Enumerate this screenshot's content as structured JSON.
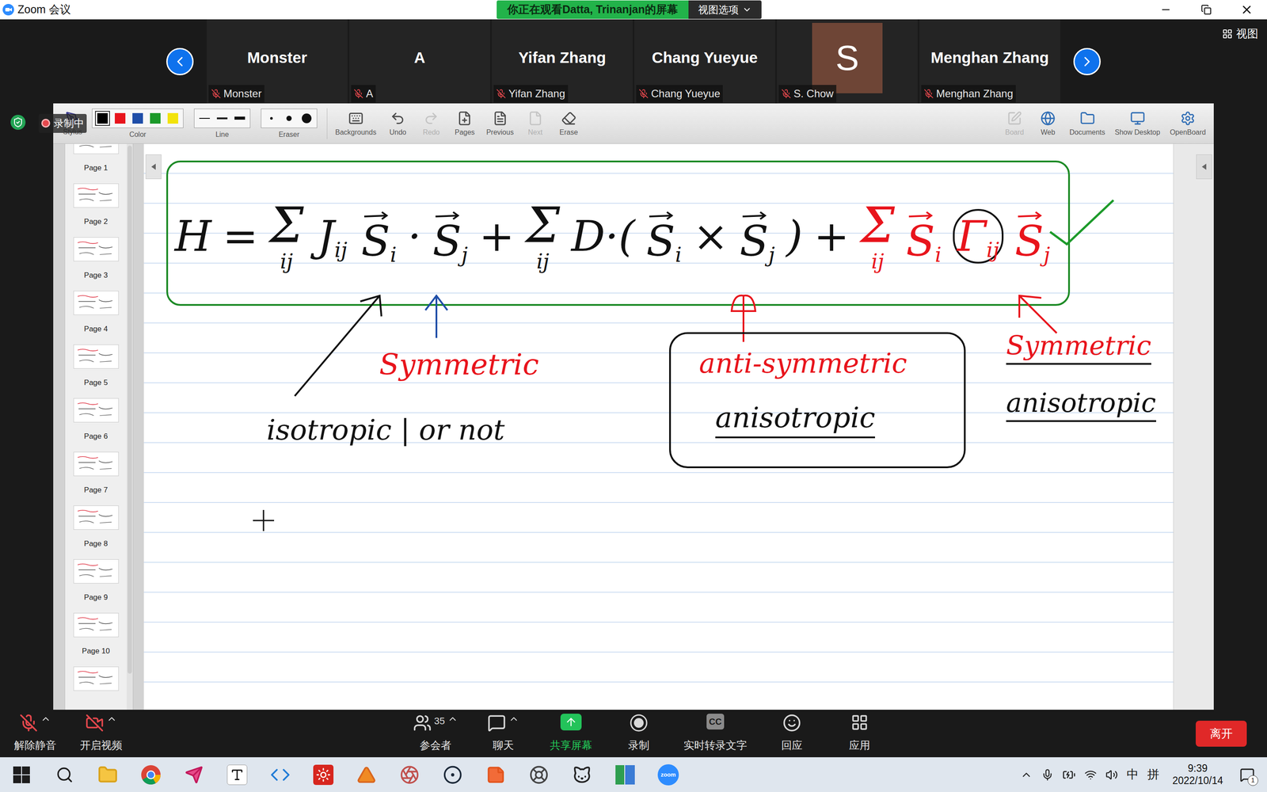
{
  "window": {
    "title": "Zoom 会议"
  },
  "banner": {
    "text": "你正在观看Datta, Trinanjan的屏幕",
    "view_options": "视图选项"
  },
  "participants": [
    {
      "kind": "name",
      "name": "Monster",
      "label": "Monster",
      "muted": true
    },
    {
      "kind": "name",
      "name": "A",
      "label": "A",
      "muted": true
    },
    {
      "kind": "name",
      "name": "Yifan Zhang",
      "label": "Yifan Zhang",
      "muted": true
    },
    {
      "kind": "name",
      "name": "Chang Yueyue",
      "label": "Chang Yueyue",
      "muted": true
    },
    {
      "kind": "avatar",
      "name": "S",
      "label": "S. Chow",
      "muted": true
    },
    {
      "kind": "name",
      "name": "Menghan Zhang",
      "label": "Menghan Zhang",
      "muted": true
    }
  ],
  "view_button": "视图",
  "recording": {
    "label": "录制中",
    "on": true
  },
  "board_toolbar": {
    "stylus": "Stylus",
    "color": {
      "label": "Color",
      "swatches": [
        {
          "color": "#000000",
          "selected": true
        },
        {
          "color": "#e8141c",
          "selected": false
        },
        {
          "color": "#1f4ea8",
          "selected": false
        },
        {
          "color": "#1c9a2a",
          "selected": false
        },
        {
          "color": "#f2e30c",
          "selected": false
        }
      ]
    },
    "line": {
      "label": "Line"
    },
    "eraser": {
      "label": "Eraser"
    },
    "tools": [
      {
        "label": "Backgrounds",
        "disabled": false
      },
      {
        "label": "Undo",
        "disabled": false
      },
      {
        "label": "Redo",
        "disabled": true
      },
      {
        "label": "Pages",
        "disabled": false
      },
      {
        "label": "Previous",
        "disabled": false
      },
      {
        "label": "Next",
        "disabled": true
      },
      {
        "label": "Erase",
        "disabled": false
      }
    ],
    "right_tools": [
      {
        "label": "Board",
        "disabled": true
      },
      {
        "label": "Web",
        "disabled": false
      },
      {
        "label": "Documents",
        "disabled": false
      },
      {
        "label": "Show Desktop",
        "disabled": false
      },
      {
        "label": "OpenBoard",
        "disabled": false
      }
    ]
  },
  "pages": [
    "Page 1",
    "Page 2",
    "Page 3",
    "Page 4",
    "Page 5",
    "Page 6",
    "Page 7",
    "Page 8",
    "Page 9",
    "Page 10"
  ],
  "equation": [
    {
      "kind": "text",
      "text": "H",
      "color": "#111111"
    },
    {
      "kind": "text",
      "text": "=",
      "color": "#111111"
    },
    {
      "kind": "sum",
      "text": "Σ",
      "index": "ij",
      "color": "#111111"
    },
    {
      "kind": "sym",
      "text": "J",
      "sub": "ij",
      "color": "#111111",
      "circled": false
    },
    {
      "kind": "vec",
      "text": "S",
      "sub": "i",
      "color": "#111111"
    },
    {
      "kind": "text",
      "text": "·",
      "color": "#111111"
    },
    {
      "kind": "vec",
      "text": "S",
      "sub": "j",
      "color": "#111111"
    },
    {
      "kind": "text",
      "text": "+",
      "color": "#111111"
    },
    {
      "kind": "sum",
      "text": "Σ",
      "index": "ij",
      "color": "#111111"
    },
    {
      "kind": "text",
      "text": "D·(",
      "color": "#111111"
    },
    {
      "kind": "vec",
      "text": "S",
      "sub": "i",
      "color": "#111111"
    },
    {
      "kind": "text",
      "text": "×",
      "color": "#111111"
    },
    {
      "kind": "vec",
      "text": "S",
      "sub": "j",
      "color": "#111111"
    },
    {
      "kind": "text",
      "text": ")",
      "color": "#111111"
    },
    {
      "kind": "text",
      "text": "+",
      "color": "#111111"
    },
    {
      "kind": "sum",
      "text": "Σ",
      "index": "ij",
      "color": "#e8141c"
    },
    {
      "kind": "vec",
      "text": "S",
      "sub": "i",
      "color": "#e8141c"
    },
    {
      "kind": "sym",
      "text": "Γ",
      "sub": "ij",
      "color": "#e8141c",
      "circled": true
    },
    {
      "kind": "vec",
      "text": "S",
      "sub": "j",
      "color": "#e8141c"
    }
  ],
  "annotations": [
    {
      "text": "Symmetric",
      "color": "#e8141c",
      "underline": false
    },
    {
      "text": "isotropic | or not",
      "color": "#111111",
      "underline": false
    },
    {
      "text": "anti-symmetric",
      "color": "#e8141c",
      "underline": false
    },
    {
      "text": "anisotropic",
      "color": "#111111",
      "underline": true
    },
    {
      "text": "Symmetric",
      "color": "#e8141c",
      "underline": true
    },
    {
      "text": "anisotropic",
      "color": "#111111",
      "underline": true
    }
  ],
  "controls": [
    {
      "kind": "mute",
      "label": "解除静音",
      "muted": true,
      "menu": true
    },
    {
      "kind": "video",
      "label": "开启视频",
      "off": true,
      "menu": true
    },
    {
      "kind": "participants",
      "label": "参会者",
      "count": "35",
      "menu": true
    },
    {
      "kind": "chat",
      "label": "聊天",
      "menu": true
    },
    {
      "kind": "share",
      "label": "共享屏幕",
      "active": true,
      "menu": false
    },
    {
      "kind": "record",
      "label": "录制",
      "menu": false
    },
    {
      "kind": "captions",
      "label": "实时转录文字",
      "icon_text": "CC",
      "menu": false
    },
    {
      "kind": "react",
      "label": "回应",
      "menu": false
    },
    {
      "kind": "apps",
      "label": "应用",
      "menu": false
    }
  ],
  "leave_button": "离开",
  "taskbar": {
    "zoom_label": "zoom",
    "ime": "中",
    "ime_mode": "拼",
    "time": "9:39",
    "date": "2022/10/14",
    "notifications": "1"
  }
}
